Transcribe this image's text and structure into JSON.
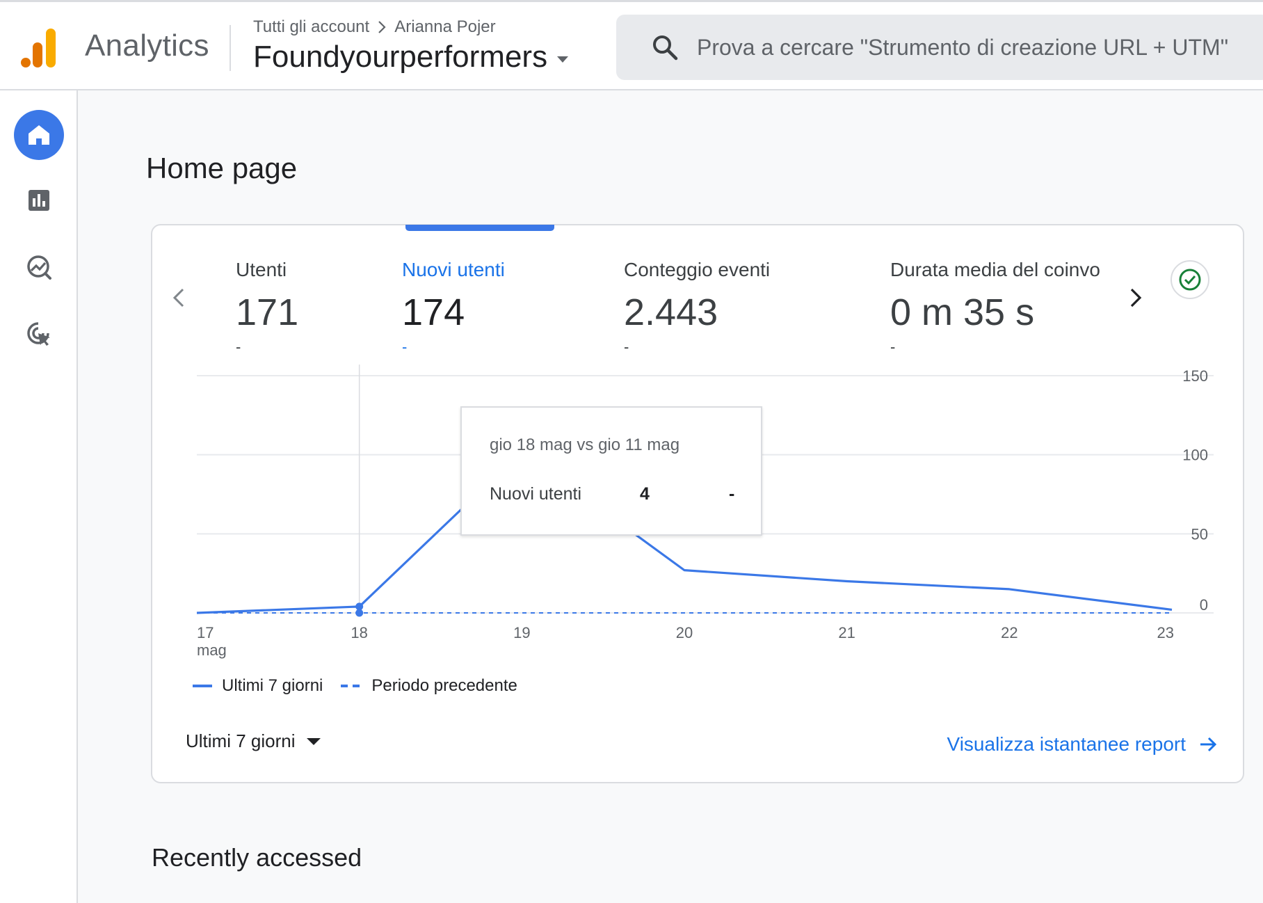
{
  "header": {
    "app_name": "Analytics",
    "breadcrumb": [
      "Tutti gli account",
      "Arianna Pojer"
    ],
    "property_name": "Foundyourperformers",
    "search_placeholder": "Prova a cercare \"Strumento di creazione URL + UTM\""
  },
  "sidebar": {
    "items": [
      {
        "name": "home",
        "icon": "home-icon",
        "active": true
      },
      {
        "name": "reports",
        "icon": "bar-chart-icon",
        "active": false
      },
      {
        "name": "explore",
        "icon": "explore-trend-icon",
        "active": false
      },
      {
        "name": "advertising",
        "icon": "ads-cursor-icon",
        "active": false
      }
    ]
  },
  "page": {
    "title": "Home page",
    "recent_title": "Recently accessed"
  },
  "metrics": [
    {
      "label": "Utenti",
      "value": "171",
      "delta": "-"
    },
    {
      "label": "Nuovi utenti",
      "value": "174",
      "delta": "-"
    },
    {
      "label": "Conteggio eventi",
      "value": "2.443",
      "delta": "-"
    },
    {
      "label": "Durata media del coinvo",
      "value": "0 m 35 s",
      "delta": "-"
    }
  ],
  "tooltip": {
    "title": "gio 18 mag vs gio 11 mag",
    "metric": "Nuovi utenti",
    "value": "4",
    "delta": "-"
  },
  "chart_data": {
    "type": "line",
    "x": [
      "17\nmag",
      "18",
      "19",
      "20",
      "21",
      "22",
      "23"
    ],
    "y_ticks": [
      0,
      50,
      100,
      150
    ],
    "ylim": [
      0,
      150
    ],
    "series": [
      {
        "name": "Ultimi 7 giorni",
        "style": "solid",
        "values": [
          0,
          4,
          102,
          27,
          20,
          15,
          2
        ]
      },
      {
        "name": "Periodo precedente",
        "style": "dashed",
        "values": [
          0,
          0,
          0,
          0,
          0,
          0,
          0
        ]
      }
    ],
    "highlight_index": 1,
    "grid": true,
    "legend": "bottom-left"
  },
  "footer": {
    "period_label": "Ultimi 7 giorni",
    "view_report_label": "Visualizza istantanee report"
  },
  "colors": {
    "accent": "#3b78e7",
    "link": "#1a73e8",
    "success": "#188038"
  }
}
